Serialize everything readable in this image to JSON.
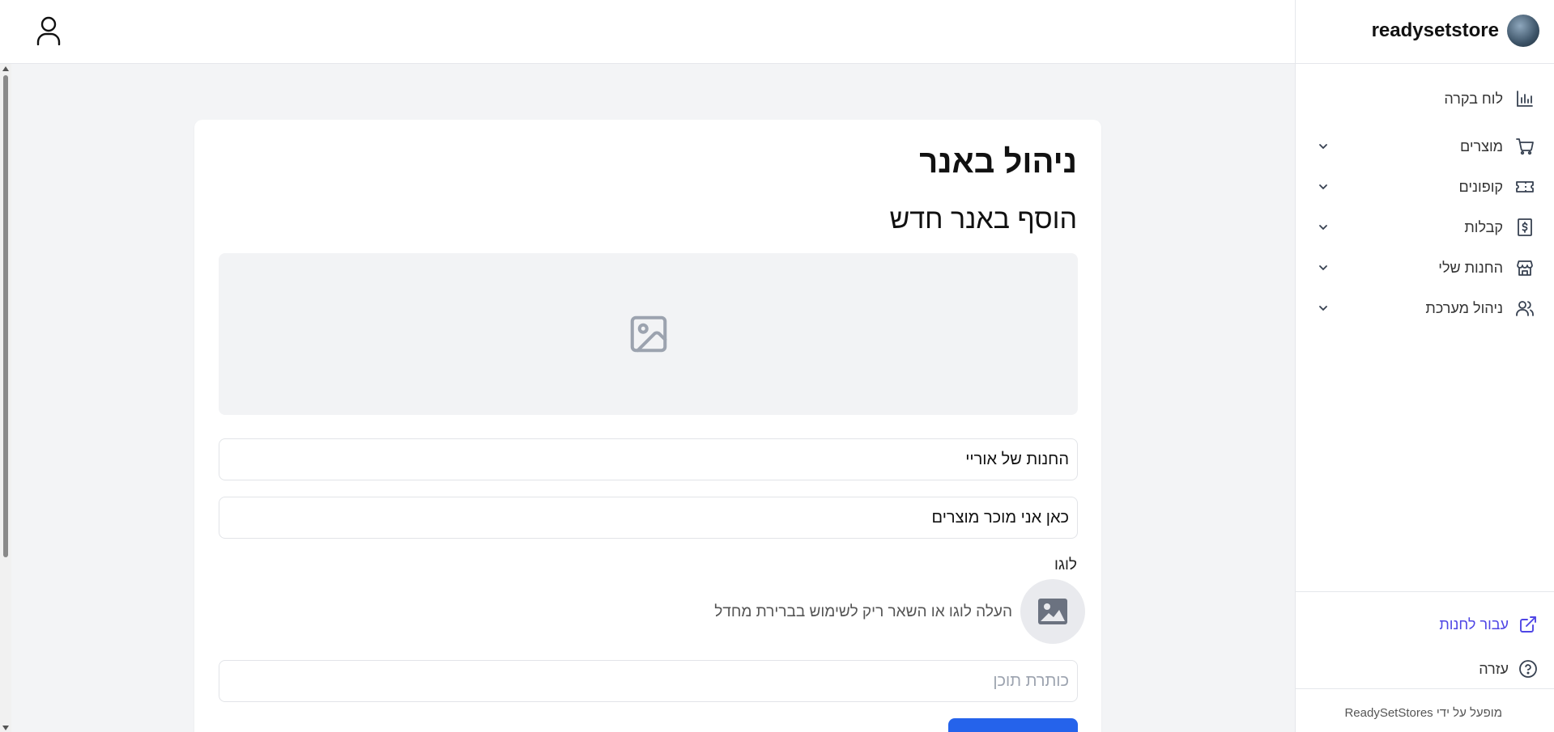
{
  "header": {
    "user_icon": "user-icon"
  },
  "sidebar": {
    "brand_name": "readysetstore",
    "items": [
      {
        "label": "לוח בקרה",
        "icon": "bar-chart-icon",
        "expandable": false
      },
      {
        "label": "מוצרים",
        "icon": "shopping-cart-icon",
        "expandable": true
      },
      {
        "label": "קופונים",
        "icon": "ticket-icon",
        "expandable": true
      },
      {
        "label": "קבלות",
        "icon": "receipt-icon",
        "expandable": true
      },
      {
        "label": "החנות שלי",
        "icon": "store-icon",
        "expandable": true
      },
      {
        "label": "ניהול מערכת",
        "icon": "users-icon",
        "expandable": true
      }
    ],
    "store_link_label": "עבור לחנות",
    "help_label": "עזרה",
    "powered_by": "מופעל על ידי ReadySetStores"
  },
  "main": {
    "page_title": "ניהול באנר",
    "section_title": "הוסף באנר חדש",
    "store_name_value": "החנות של אוריי",
    "description_value": "כאן אני מוכר מוצרים",
    "logo_label": "לוגו",
    "logo_hint": "העלה לוגו או השאר ריק לשימוש בברירת מחדל",
    "content_title_placeholder": "כותרת תוכן"
  },
  "colors": {
    "accent": "#2563eb",
    "link": "#4f46e5",
    "background": "#f3f4f6"
  }
}
